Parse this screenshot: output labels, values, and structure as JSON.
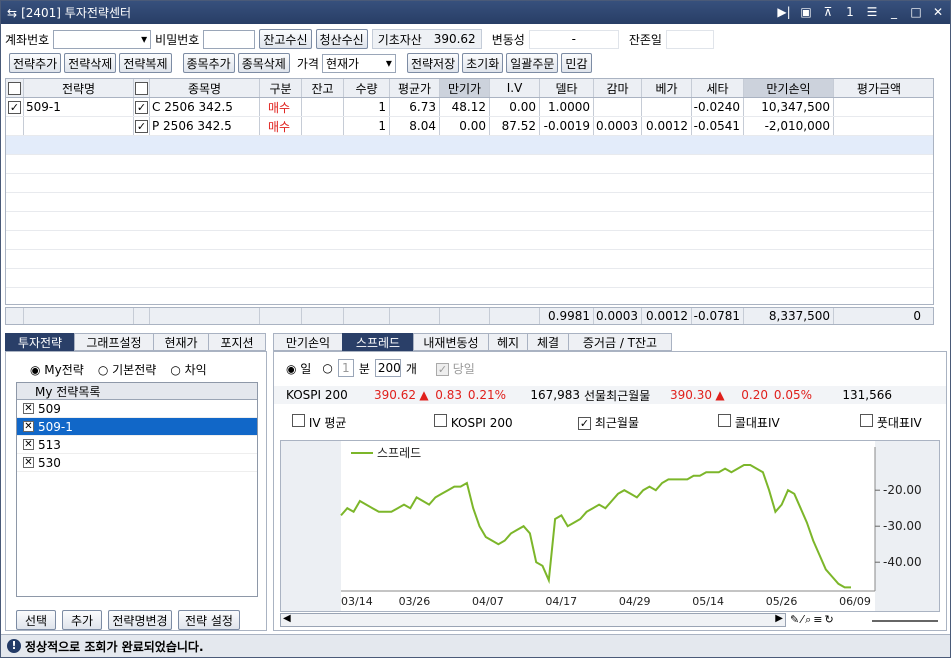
{
  "title": "[2401] 투자전략센터",
  "top": {
    "account_label": "계좌번호",
    "password_label": "비밀번호",
    "balance_btn": "잔고수신",
    "settle_btn": "청산수신",
    "base_asset_label": "기초자산",
    "base_asset_value": "390.62",
    "volatility_label": "변동성",
    "volatility_value": "-",
    "remain_label": "잔존일"
  },
  "toolbar": {
    "add_strategy": "전략추가",
    "delete_strategy": "전략삭제",
    "copy_strategy": "전략복제",
    "add_item": "종목추가",
    "delete_item": "종목삭제",
    "price_label": "가격",
    "price_select": "현재가",
    "save_strategy": "전략저장",
    "reset": "초기화",
    "bulk_order": "일괄주문",
    "sensitivity": "민감"
  },
  "grid": {
    "headers": [
      "전략명",
      "종목명",
      "구분",
      "잔고",
      "수량",
      "평균가",
      "만기가",
      "I.V",
      "델타",
      "감마",
      "베가",
      "세타",
      "만기손익",
      "평가금액"
    ],
    "rows": [
      {
        "strategy": "509-1",
        "item": "C 2506 342.5",
        "side": "매수",
        "balance": "",
        "qty": "1",
        "avg": "6.73",
        "expiry": "48.12",
        "iv": "0.00",
        "delta": "1.0000",
        "gamma": "",
        "vega": "",
        "theta": "-0.0240",
        "pnl": "10,347,500",
        "eval": ""
      },
      {
        "strategy": "",
        "item": "P 2506 342.5",
        "side": "매수",
        "balance": "",
        "qty": "1",
        "avg": "8.04",
        "expiry": "0.00",
        "iv": "87.52",
        "delta": "-0.0019",
        "gamma": "0.0003",
        "vega": "0.0012",
        "theta": "-0.0541",
        "pnl": "-2,010,000",
        "eval": ""
      }
    ],
    "sum": {
      "delta": "0.9981",
      "gamma": "0.0003",
      "vega": "0.0012",
      "theta": "-0.0781",
      "pnl": "8,337,500",
      "eval": "0"
    }
  },
  "left": {
    "tabs": [
      "투자전략",
      "그래프설정",
      "현재가",
      "포지션"
    ],
    "radio_my": "My전략",
    "radio_basic": "기본전략",
    "radio_diff": "차익",
    "list_header": "My 전략목록",
    "items": [
      "509",
      "509-1",
      "513",
      "530"
    ],
    "btn_select": "선택",
    "btn_add": "추가",
    "btn_rename": "전략명변경",
    "btn_settings": "전략 설정"
  },
  "right": {
    "tabs": [
      "만기손익",
      "스프레드",
      "내재변동성",
      "헤지",
      "체결",
      "증거금 / T잔고"
    ],
    "radio_day": "일",
    "radio_min": "분",
    "min_value": "1",
    "count_value": "200",
    "count_unit": "개",
    "today_label": "당일",
    "kospi_label": "KOSPI 200",
    "kospi_price": "390.62",
    "kospi_change": "0.83",
    "kospi_pct": "0.21%",
    "kospi_vol": "167,983",
    "fut_label": "선물최근월물",
    "fut_price": "390.30",
    "fut_change": "0.20",
    "fut_pct": "0.05%",
    "fut_vol": "131,566",
    "checks": [
      "IV 평균",
      "KOSPI 200",
      "최근월물",
      "콜대표IV",
      "풋대표IV"
    ]
  },
  "chart_data": {
    "type": "line",
    "series": [
      {
        "name": "스프레드",
        "color": "#7cb62a",
        "values": [
          -27,
          -25,
          -26,
          -23,
          -24,
          -25,
          -26,
          -26,
          -26,
          -25,
          -24,
          -25,
          -22,
          -23,
          -24,
          -22,
          -21,
          -20,
          -19,
          -19,
          -18,
          -25,
          -30,
          -33,
          -34,
          -35,
          -34,
          -32,
          -31,
          -30,
          -32,
          -40,
          -41,
          -45,
          -28,
          -27,
          -30,
          -29,
          -28,
          -26,
          -25,
          -24,
          -25,
          -23,
          -21,
          -20,
          -21,
          -22,
          -20,
          -19,
          -20,
          -18,
          -17,
          -17,
          -17,
          -17,
          -16,
          -16,
          -15,
          -15,
          -15,
          -14,
          -15,
          -14,
          -13,
          -13,
          -14,
          -15,
          -20,
          -26,
          -24,
          -20,
          -21,
          -25,
          -29,
          -34,
          -38,
          -42,
          -44,
          -46,
          -47,
          -47
        ]
      }
    ],
    "x_ticks": [
      "03/14",
      "03/26",
      "04/07",
      "04/17",
      "04/29",
      "05/14",
      "05/26",
      "06/09"
    ],
    "y_ticks": [
      "-20.00",
      "-30.00",
      "-40.00"
    ],
    "ylim": [
      -48,
      -8
    ]
  },
  "status": "정상적으로 조회가 완료되었습니다."
}
